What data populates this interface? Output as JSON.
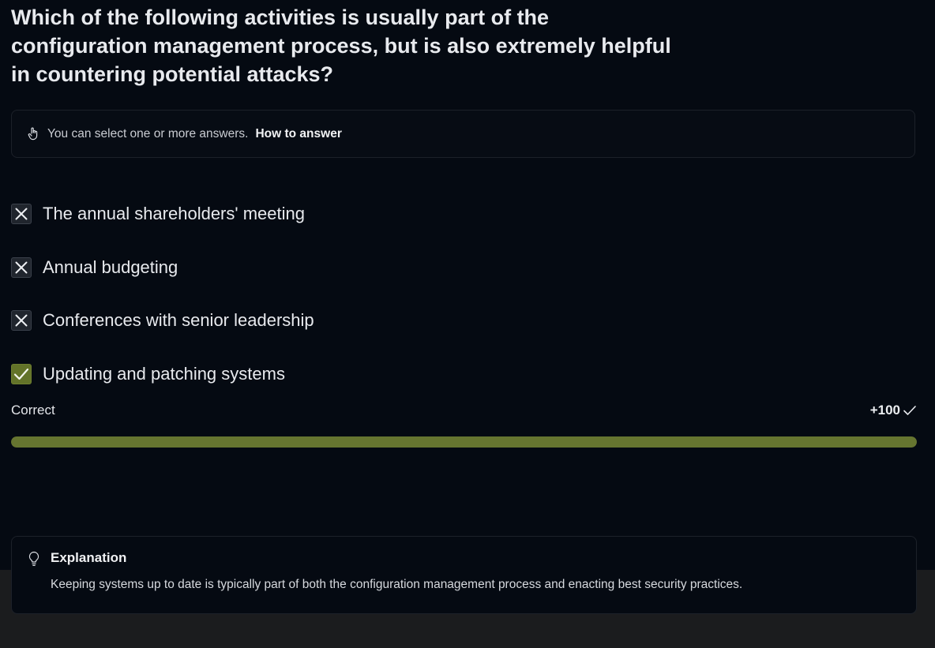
{
  "question": {
    "text": "Which of the following activities is usually part of the configuration management process, but is also extremely helpful in countering potential attacks?"
  },
  "hint": {
    "icon": "pointing-hand-icon",
    "text": "You can select one or more answers.",
    "link_label": "How to answer"
  },
  "options": [
    {
      "label": "The annual shareholders' meeting",
      "state": "incorrect",
      "icon": "x-icon"
    },
    {
      "label": "Annual budgeting",
      "state": "incorrect",
      "icon": "x-icon"
    },
    {
      "label": "Conferences with senior leadership",
      "state": "incorrect",
      "icon": "x-icon"
    },
    {
      "label": "Updating and patching systems",
      "state": "correct",
      "icon": "checkmark-icon"
    }
  ],
  "result": {
    "label": "Correct",
    "score": "+100",
    "progress_fraction": 1.0
  },
  "explanation": {
    "icon": "lightbulb-icon",
    "title": "Explanation",
    "text": "Keeping systems up to date is typically part of both the configuration management process and enacting best security practices."
  },
  "colors": {
    "background": "#050a12",
    "accent_green": "#637329",
    "bottom_band": "#1b1c1e"
  }
}
